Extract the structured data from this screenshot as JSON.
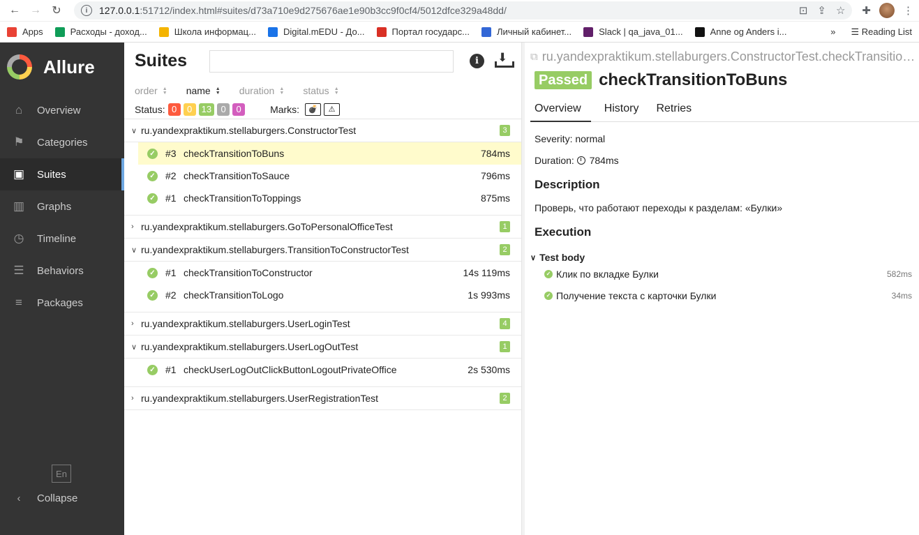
{
  "browser": {
    "url_host": "127.0.0.1",
    "url_path": ":51712/index.html#suites/d73a710e9d275676ae1e90b3cc9f0cf4/5012dfce329a48dd/",
    "bookmarks": [
      {
        "label": "Apps",
        "color": "#e94235"
      },
      {
        "label": "Расходы - доход...",
        "color": "#0f9d58"
      },
      {
        "label": "Школа информац...",
        "color": "#f4b400"
      },
      {
        "label": "Digital.mEDU - До...",
        "color": "#1a73e8"
      },
      {
        "label": "Портал государс...",
        "color": "#d93025"
      },
      {
        "label": "Личный кабинет...",
        "color": "#3367d6"
      },
      {
        "label": "Slack | qa_java_01...",
        "color": "#611f69"
      },
      {
        "label": "Anne og Anders i...",
        "color": "#111111"
      }
    ],
    "more": "»",
    "reading_list": "Reading List"
  },
  "sidebar": {
    "brand": "Allure",
    "items": [
      {
        "label": "Overview",
        "icon": "home-icon"
      },
      {
        "label": "Categories",
        "icon": "flag-icon"
      },
      {
        "label": "Suites",
        "icon": "briefcase-icon"
      },
      {
        "label": "Graphs",
        "icon": "bar-chart-icon"
      },
      {
        "label": "Timeline",
        "icon": "clock-icon"
      },
      {
        "label": "Behaviors",
        "icon": "list-icon"
      },
      {
        "label": "Packages",
        "icon": "align-left-icon"
      }
    ],
    "lang": "En",
    "collapse": "Collapse"
  },
  "suites": {
    "title": "Suites",
    "sort": [
      "order",
      "name",
      "duration",
      "status"
    ],
    "status_label": "Status:",
    "status_counts": [
      {
        "value": "0",
        "color": "#fd5a3e"
      },
      {
        "value": "0",
        "color": "#ffd050"
      },
      {
        "value": "13",
        "color": "#97cc64"
      },
      {
        "value": "0",
        "color": "#aaaaaa"
      },
      {
        "value": "0",
        "color": "#d35ebe"
      }
    ],
    "marks_label": "Marks:",
    "groups": [
      {
        "name": "ru.yandexpraktikum.stellaburgers.ConstructorTest",
        "count": "3",
        "expanded": true,
        "tests": [
          {
            "num": "#3",
            "name": "checkTransitionToBuns",
            "duration": "784ms",
            "selected": true
          },
          {
            "num": "#2",
            "name": "checkTransitionToSauce",
            "duration": "796ms"
          },
          {
            "num": "#1",
            "name": "checkTransitionToToppings",
            "duration": "875ms"
          }
        ]
      },
      {
        "name": "ru.yandexpraktikum.stellaburgers.GoToPersonalOfficeTest",
        "count": "1",
        "expanded": false,
        "tests": []
      },
      {
        "name": "ru.yandexpraktikum.stellaburgers.TransitionToConstructorTest",
        "count": "2",
        "expanded": true,
        "tests": [
          {
            "num": "#1",
            "name": "checkTransitionToConstructor",
            "duration": "14s 119ms"
          },
          {
            "num": "#2",
            "name": "checkTransitionToLogo",
            "duration": "1s 993ms"
          }
        ]
      },
      {
        "name": "ru.yandexpraktikum.stellaburgers.UserLoginTest",
        "count": "4",
        "expanded": false,
        "tests": []
      },
      {
        "name": "ru.yandexpraktikum.stellaburgers.UserLogOutTest",
        "count": "1",
        "expanded": true,
        "tests": [
          {
            "num": "#1",
            "name": "checkUserLogOutClickButtonLogoutPrivateOffice",
            "duration": "2s 530ms"
          }
        ]
      },
      {
        "name": "ru.yandexpraktikum.stellaburgers.UserRegistrationTest",
        "count": "2",
        "expanded": false,
        "tests": []
      }
    ]
  },
  "detail": {
    "path": "ru.yandexpraktikum.stellaburgers.ConstructorTest.checkTransitio…",
    "status": "Passed",
    "name": "checkTransitionToBuns",
    "tabs": [
      "Overview",
      "History",
      "Retries"
    ],
    "severity": "Severity: normal",
    "duration_label": "Duration:",
    "duration": "784ms",
    "description_title": "Description",
    "description": "Проверь, что работают переходы к разделам: «Булки»",
    "execution_title": "Execution",
    "test_body": "Test body",
    "steps": [
      {
        "name": "Клик по вкладке Булки",
        "duration": "582ms"
      },
      {
        "name": "Получение текста с карточки Булки",
        "duration": "34ms"
      }
    ]
  }
}
